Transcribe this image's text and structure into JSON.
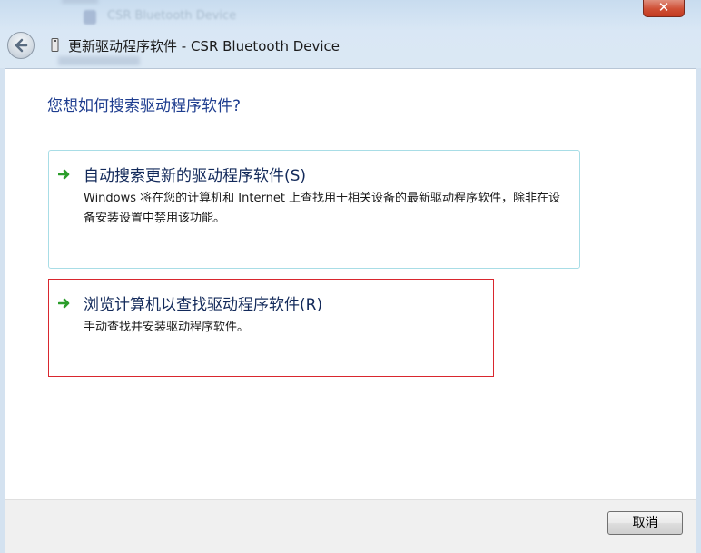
{
  "window": {
    "title": "更新驱动程序软件 - CSR Bluetooth Device",
    "close_label": "✕",
    "background_item_text": "CSR Bluetooth Device"
  },
  "main": {
    "question": "您想如何搜索驱动程序软件?",
    "options": [
      {
        "title": "自动搜索更新的驱动程序软件(S)",
        "description": "Windows 将在您的计算机和 Internet 上查找用于相关设备的最新驱动程序软件，除非在设备安装设置中禁用该功能。"
      },
      {
        "title": "浏览计算机以查找驱动程序软件(R)",
        "description": "手动查找并安装驱动程序软件。"
      }
    ]
  },
  "footer": {
    "cancel_label": "取消"
  },
  "colors": {
    "question_text": "#1e3d8f",
    "option_title_text": "#12295a",
    "option_arrow": "#2a9d2a",
    "highlight_border": "#d9272e",
    "option_border": "#a8dde6"
  },
  "icons": {
    "back": "back-arrow-icon",
    "device": "bluetooth-device-icon",
    "option_arrow": "green-arrow-icon",
    "close": "close-icon"
  }
}
